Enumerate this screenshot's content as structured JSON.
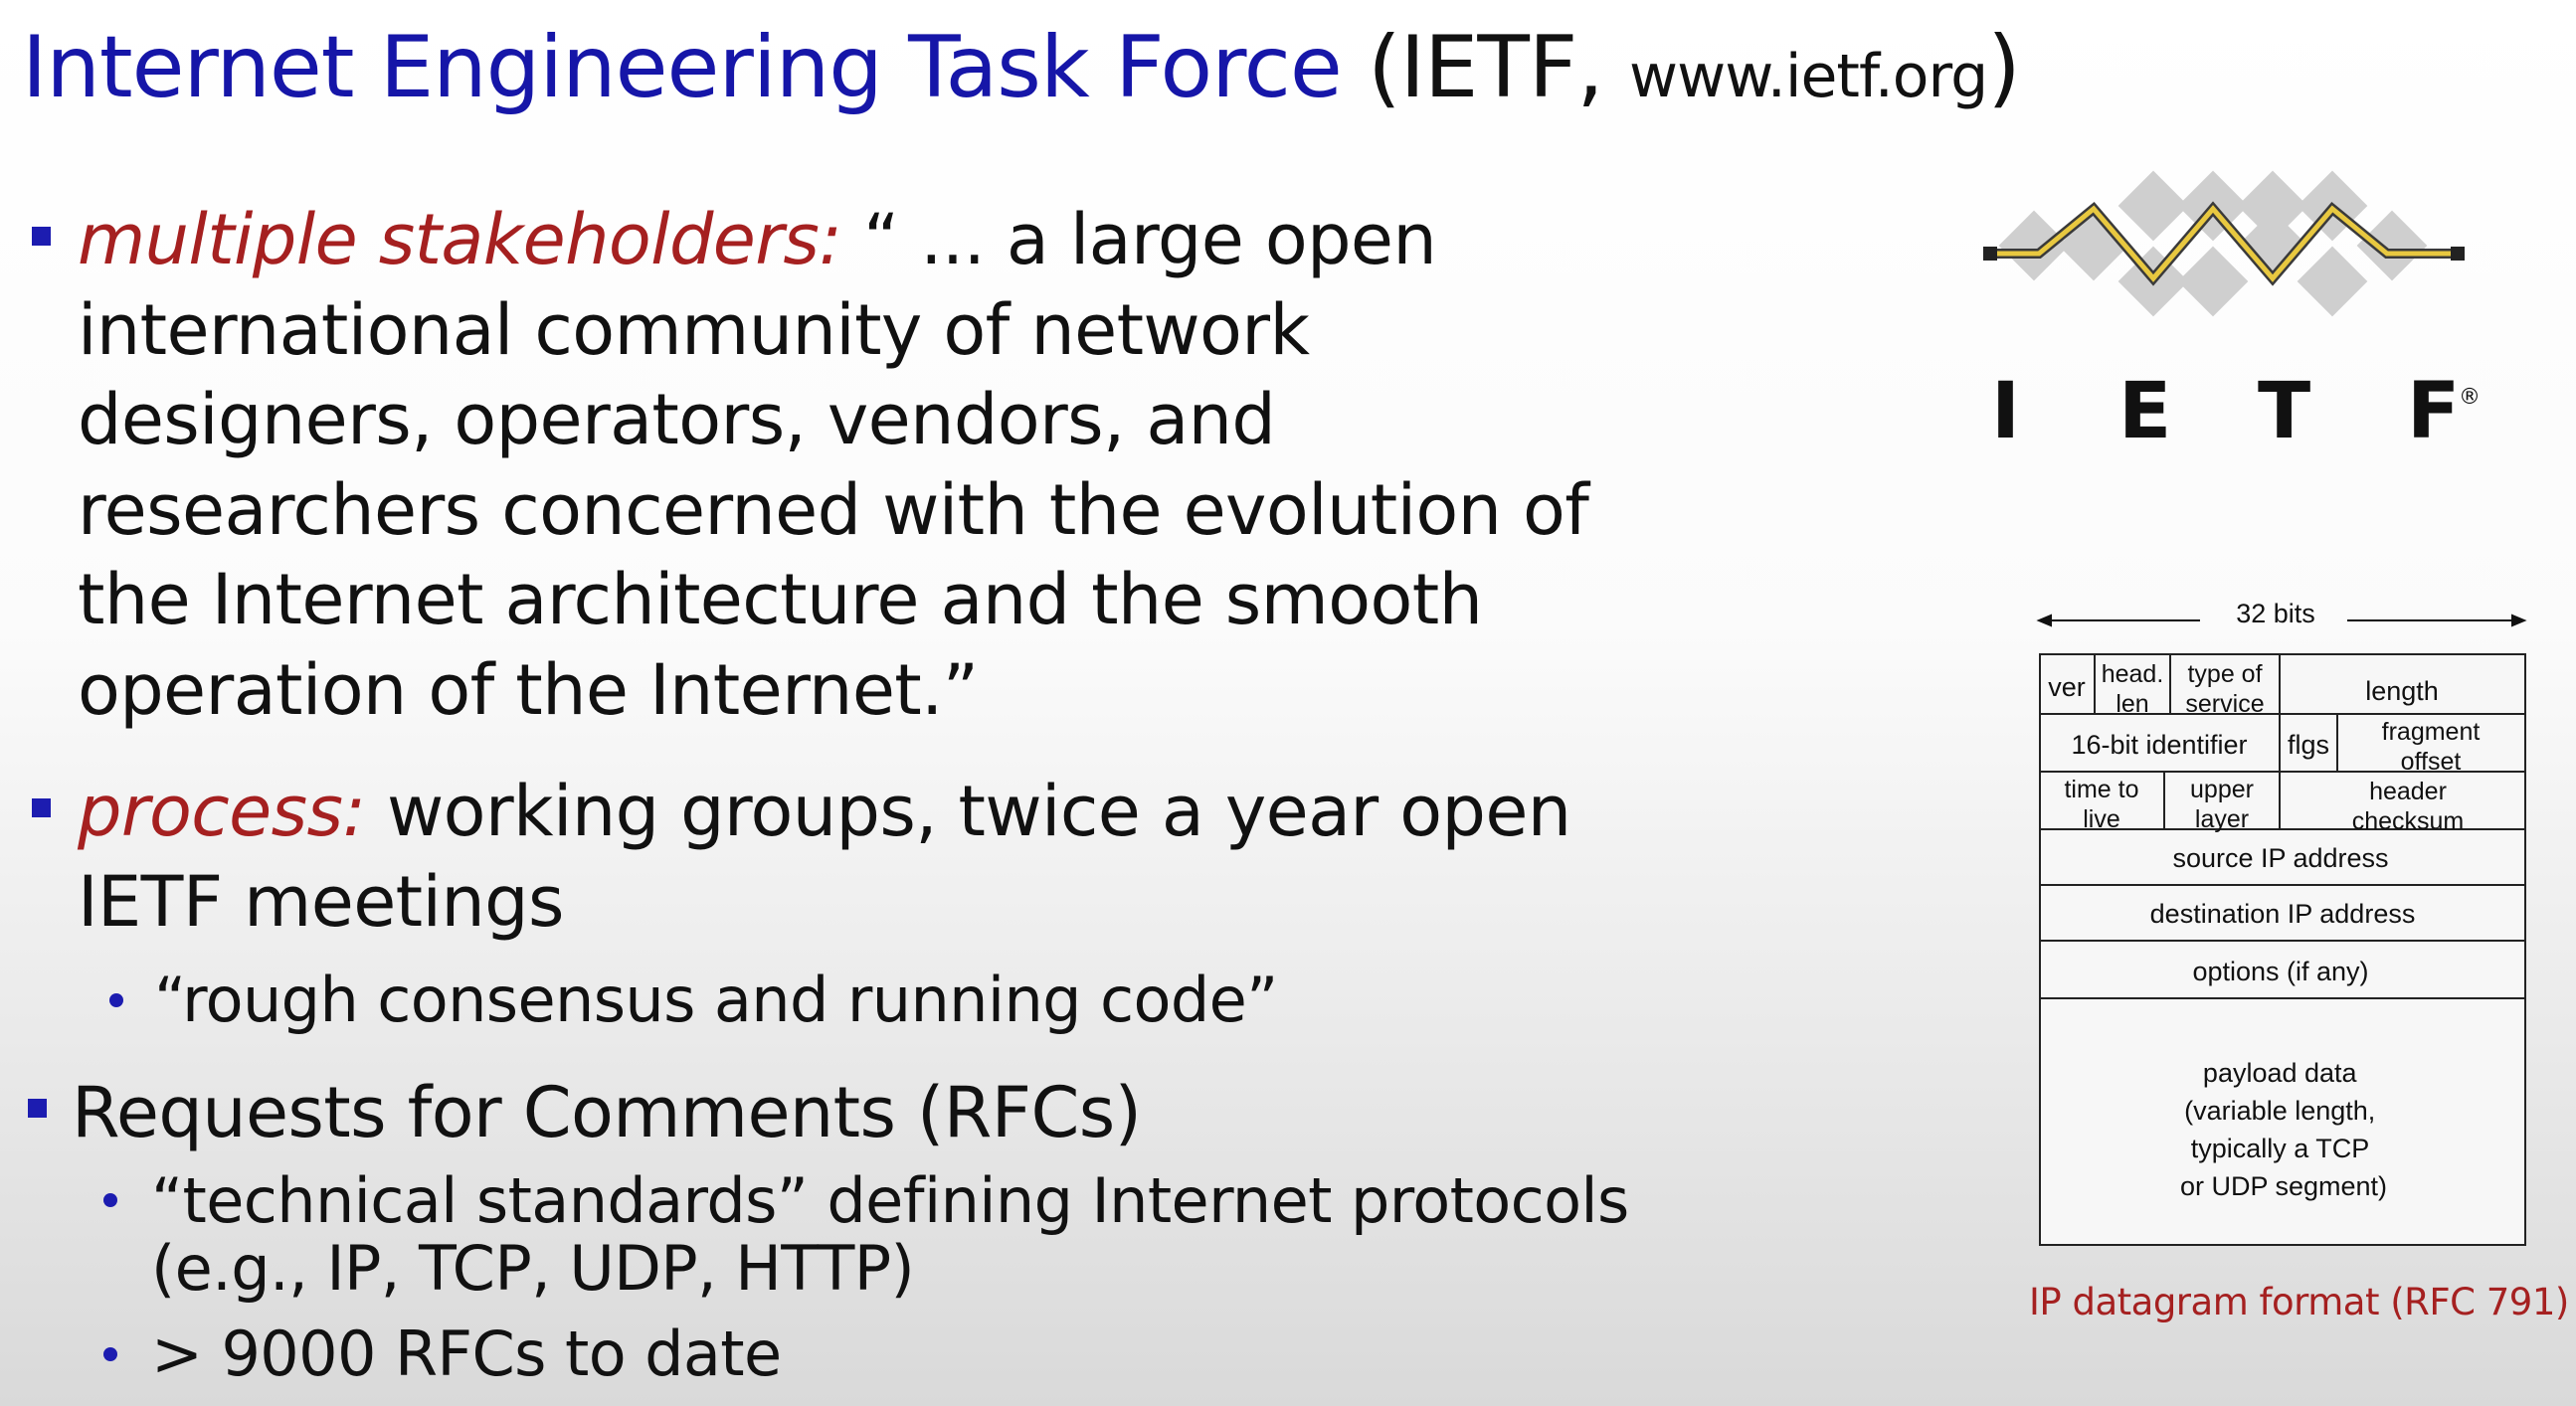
{
  "title": {
    "main": "Internet Engineering Task Force",
    "paren_open": " (IETF, ",
    "url": "www.ietf.org",
    "paren_close": ")"
  },
  "bullets": {
    "stakeholders": {
      "label": "multiple stakeholders:",
      "lines": [
        " “ ... a large open",
        "international community of network",
        "designers, operators, vendors, and",
        "researchers concerned with the evolution of",
        "the Internet architecture and the smooth",
        "operation of the Internet.”"
      ]
    },
    "process": {
      "label": "process:",
      "lines": [
        " working groups, twice a year open",
        "IETF meetings"
      ],
      "sub": "“rough consensus and running code”"
    },
    "rfcs": {
      "label": "Requests for Comments (RFCs)",
      "sub1_lines": [
        "“technical standards” defining Internet protocols",
        "(e.g., IP, TCP, UDP, HTTP)"
      ],
      "sub2": "> 9000 RFCs to date"
    }
  },
  "logo": {
    "letters": [
      "I",
      "E",
      "T",
      "F"
    ],
    "mark": "®"
  },
  "diagram": {
    "width_label": "32 bits",
    "rows": [
      {
        "cells": [
          "ver",
          "head.\nlen",
          "type of\nservice",
          "length"
        ]
      },
      {
        "cells": [
          "16-bit identifier",
          "flgs",
          "fragment\noffset"
        ]
      },
      {
        "cells": [
          "time to\nlive",
          "upper\nlayer",
          "header\nchecksum"
        ]
      },
      {
        "cells": [
          "source IP address"
        ]
      },
      {
        "cells": [
          "destination IP address"
        ]
      },
      {
        "cells": [
          "options (if any)"
        ]
      },
      {
        "cells": [
          "payload data\n(variable length,\ntypically a TCP\nor UDP segment)"
        ]
      }
    ],
    "caption": "IP datagram format (RFC 791)"
  },
  "colors": {
    "title_blue": "#1616a8",
    "accent_red": "#a52020",
    "bullet_blue": "#1c1cb0"
  }
}
